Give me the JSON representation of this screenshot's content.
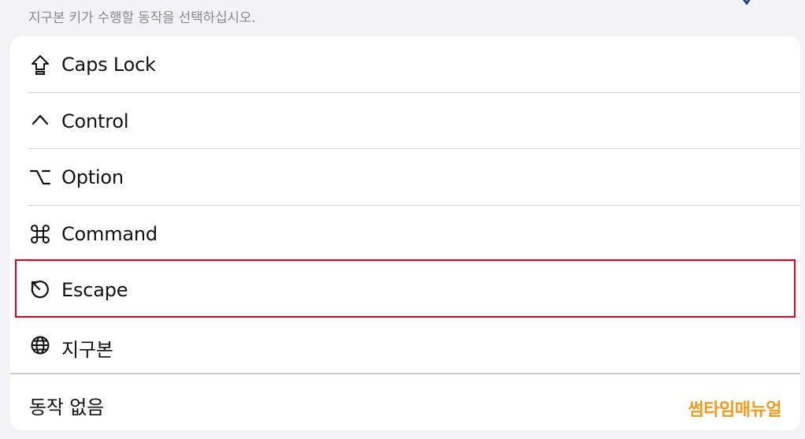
{
  "caption": "지구본 키가 수행할 동작을 선택하십시오.",
  "options": [
    {
      "label": "Caps Lock",
      "icon": "caps-lock-icon"
    },
    {
      "label": "Control",
      "icon": "control-caret-icon"
    },
    {
      "label": "Option",
      "icon": "option-key-icon"
    },
    {
      "label": "Command",
      "icon": "command-key-icon"
    },
    {
      "label": "Escape",
      "icon": "escape-icon"
    },
    {
      "label": "지구본",
      "icon": "globe-icon"
    }
  ],
  "no_action": {
    "label": "동작 없음"
  },
  "highlighted_option": "Escape",
  "highlight_color": "#e3001b",
  "watermark": "썸타임매뉴얼",
  "watermark_color": "#f39a19"
}
